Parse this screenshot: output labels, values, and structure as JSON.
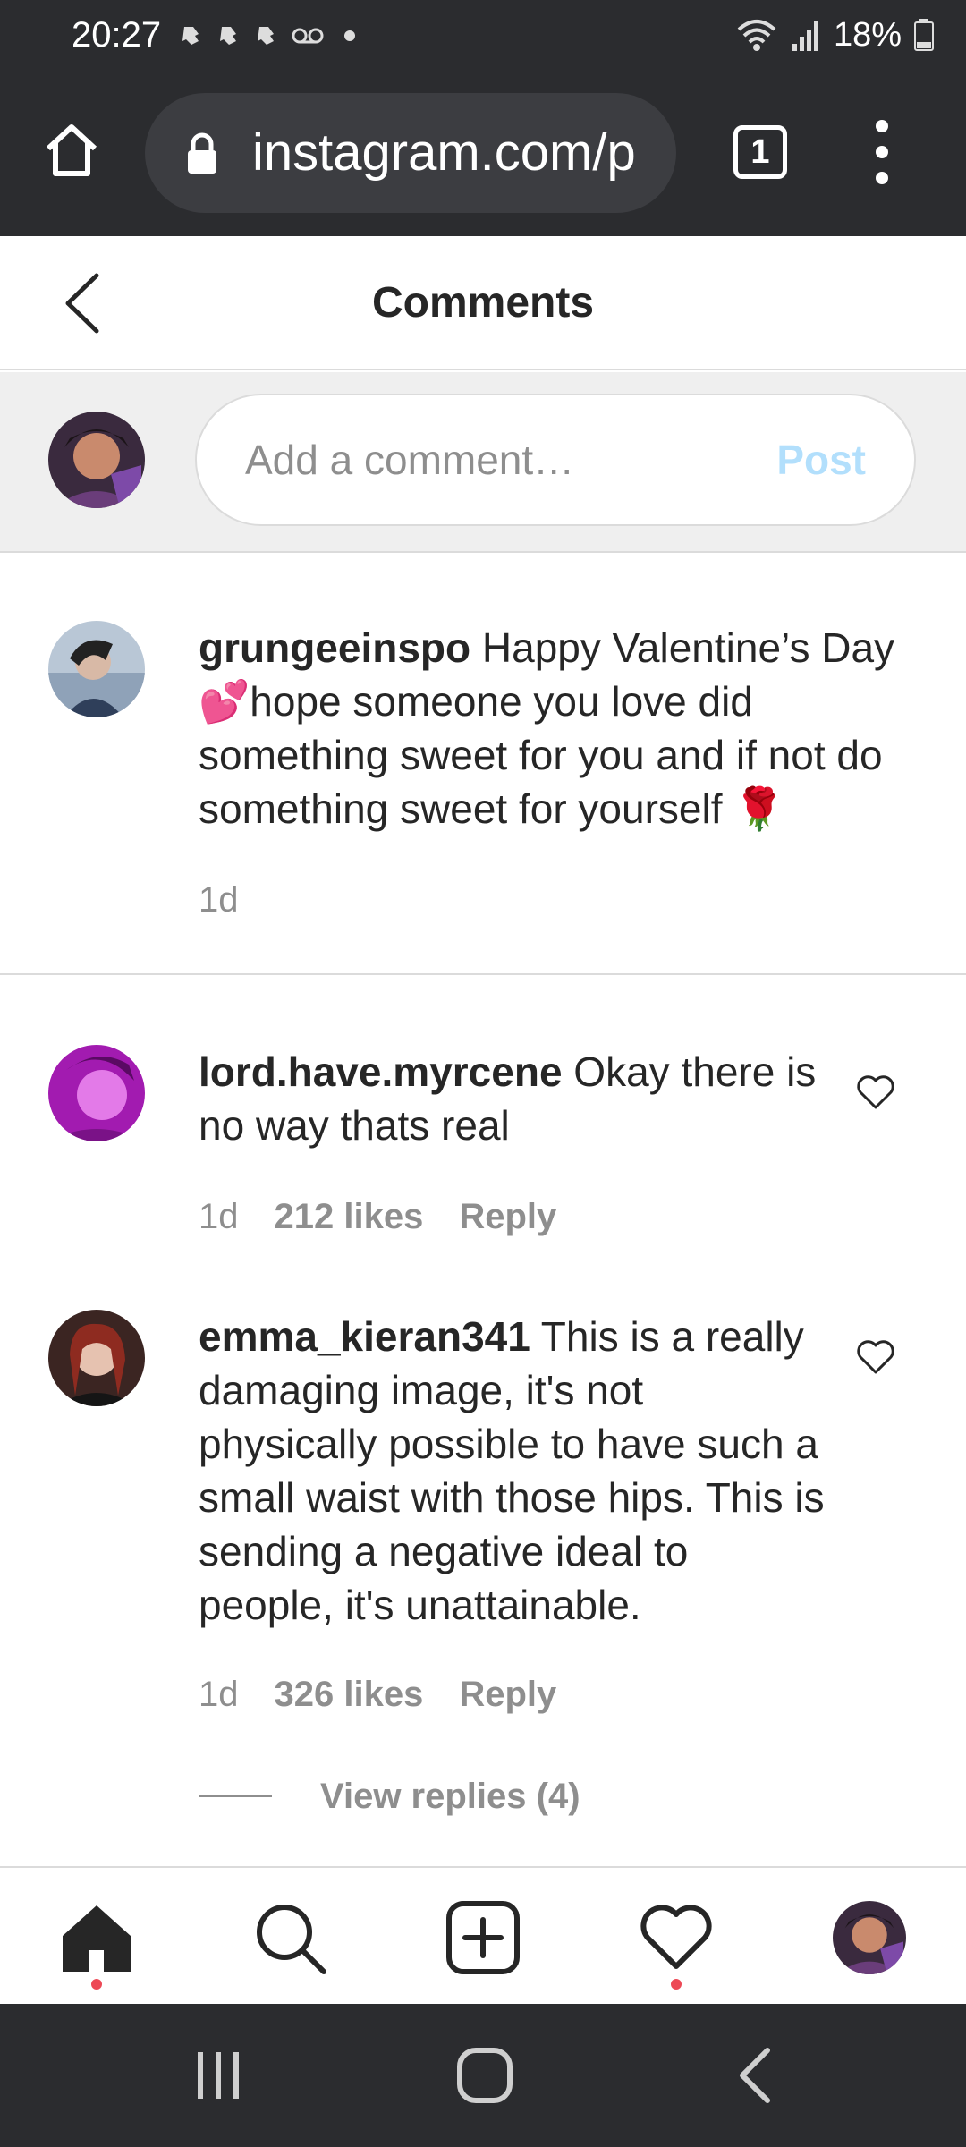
{
  "status_bar": {
    "time": "20:27",
    "battery": "18%",
    "notification_icons": [
      "app-icon",
      "app-icon",
      "app-icon",
      "voicemail-icon",
      "dot-icon"
    ],
    "system_icons": [
      "wifi-icon",
      "signal-icon",
      "battery-icon"
    ]
  },
  "browser": {
    "url": "instagram.com/p",
    "tab_count": "1"
  },
  "header": {
    "title": "Comments"
  },
  "add_comment": {
    "placeholder": "Add a comment…",
    "post_label": "Post"
  },
  "caption": {
    "username": "grungeeinspo",
    "text_1": " Happy Valentine’s Day ",
    "emoji_1": "💕",
    "text_2": "hope someone you love did something sweet for you and if not do something sweet for yourself ",
    "emoji_2": "🌹",
    "time": "1d"
  },
  "comments": [
    {
      "username": "lord.have.myrcene",
      "text": " Okay there is no way thats real",
      "time": "1d",
      "likes": "212 likes",
      "reply_label": "Reply"
    },
    {
      "username": "emma_kieran341",
      "text": " This is a really damaging image, it's not physically possible to have such a small waist with those hips. This is sending a negative ideal to people, it's unattainable.",
      "time": "1d",
      "likes": "326 likes",
      "reply_label": "Reply",
      "view_replies": "View replies (4)"
    }
  ],
  "bottom_nav": [
    "home-icon",
    "search-icon",
    "new-post-icon",
    "activity-heart-icon",
    "profile-avatar"
  ],
  "colors": {
    "chrome_bg": "#2b2c2f",
    "post_disabled": "#b2dffc",
    "notification_dot": "#ed4956",
    "secondary_text": "#8e8e8e"
  }
}
